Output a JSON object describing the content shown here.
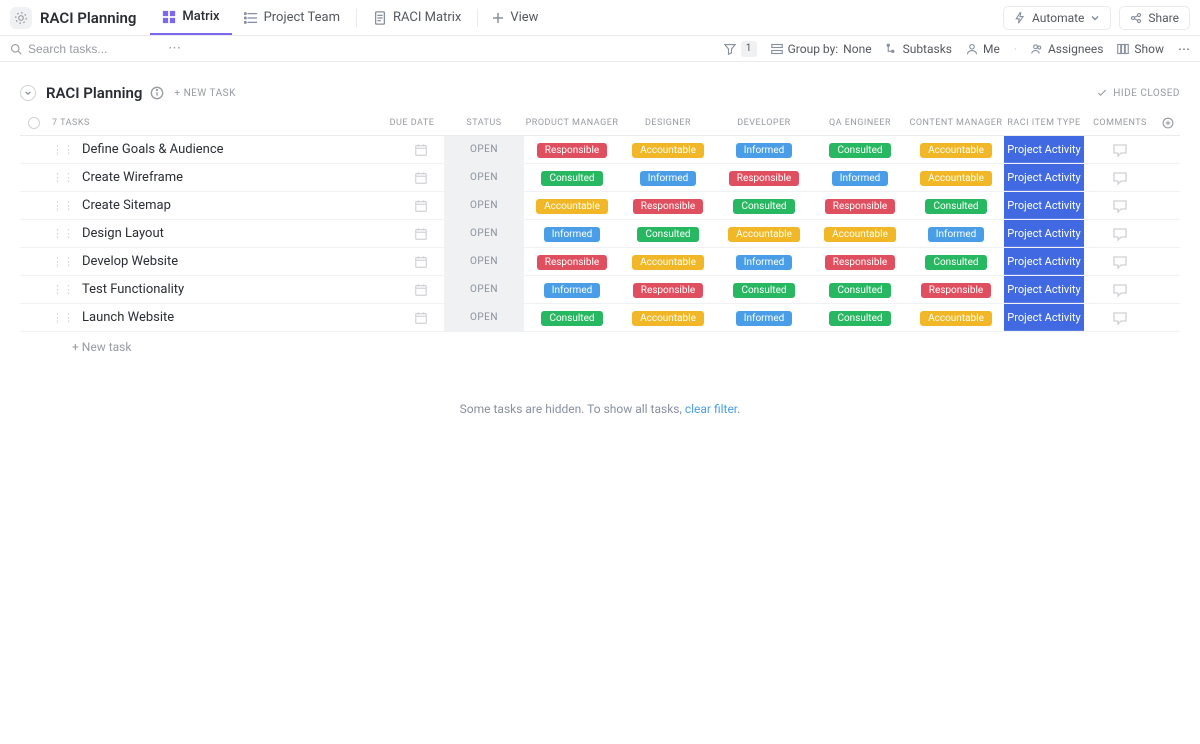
{
  "header": {
    "app_title": "RACI Planning",
    "tabs": [
      {
        "label": "Matrix"
      },
      {
        "label": "Project Team"
      },
      {
        "label": "RACI Matrix"
      }
    ],
    "view_label": "View",
    "automate_label": "Automate",
    "share_label": "Share"
  },
  "toolbar": {
    "search_placeholder": "Search tasks...",
    "filter_count": "1",
    "group_by_label": "Group by:",
    "group_by_value": "None",
    "subtasks_label": "Subtasks",
    "me_label": "Me",
    "assignees_label": "Assignees",
    "show_label": "Show"
  },
  "group": {
    "title": "RACI Planning",
    "new_task_label": "+ NEW TASK",
    "hide_closed_label": "HIDE CLOSED",
    "task_count_label": "7 TASKS"
  },
  "columns": {
    "due_date": "DUE DATE",
    "status": "STATUS",
    "roles": [
      "PRODUCT MANAGER",
      "DESIGNER",
      "DEVELOPER",
      "QA ENGINEER",
      "CONTENT MANAGER"
    ],
    "item_type": "RACI ITEM TYPE",
    "comments": "COMMENTS"
  },
  "status_open": "OPEN",
  "item_type_value": "Project Activity",
  "tasks": [
    {
      "name": "Define Goals & Audience",
      "raci": [
        "Responsible",
        "Accountable",
        "Informed",
        "Consulted",
        "Accountable"
      ]
    },
    {
      "name": "Create Wireframe",
      "raci": [
        "Consulted",
        "Informed",
        "Responsible",
        "Informed",
        "Accountable"
      ]
    },
    {
      "name": "Create Sitemap",
      "raci": [
        "Accountable",
        "Responsible",
        "Consulted",
        "Responsible",
        "Consulted"
      ]
    },
    {
      "name": "Design Layout",
      "raci": [
        "Informed",
        "Consulted",
        "Accountable",
        "Accountable",
        "Informed"
      ]
    },
    {
      "name": "Develop Website",
      "raci": [
        "Responsible",
        "Accountable",
        "Informed",
        "Responsible",
        "Consulted"
      ]
    },
    {
      "name": "Test Functionality",
      "raci": [
        "Informed",
        "Responsible",
        "Consulted",
        "Consulted",
        "Responsible"
      ]
    },
    {
      "name": "Launch Website",
      "raci": [
        "Consulted",
        "Accountable",
        "Informed",
        "Consulted",
        "Accountable"
      ]
    }
  ],
  "footer": {
    "new_task": "+ New task",
    "hidden_prefix": "Some tasks are hidden. To show all tasks, ",
    "clear_filter": "clear filter",
    "hidden_suffix": "."
  }
}
